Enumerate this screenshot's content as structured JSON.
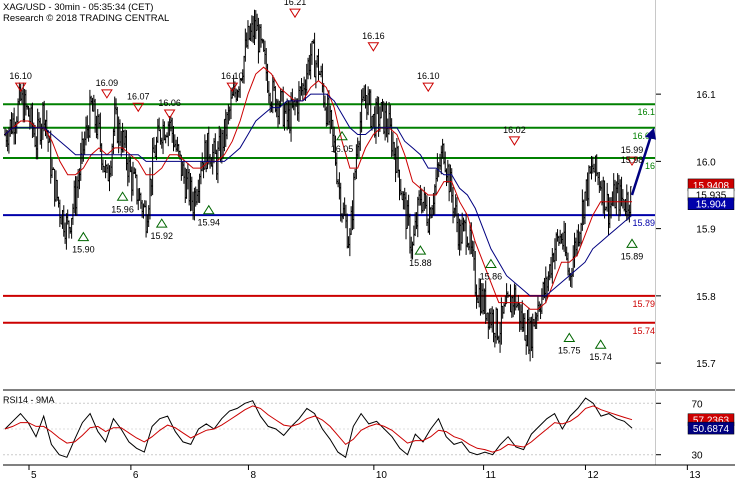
{
  "header": {
    "title": "XAG/USD - 30min - 05:35:34 (CET)",
    "copyright": "Research © 2018 TRADING CENTRAL"
  },
  "chart_data": [
    {
      "type": "candlestick",
      "title": "XAG/USD - 30min - 05:35:34 (CET)",
      "ylim": [
        15.66,
        16.24
      ],
      "grid": false,
      "x_ticks": [
        "5",
        "6",
        "8",
        "10",
        "11",
        "12",
        "13"
      ],
      "y_ticks": [
        "16.1",
        "16.0",
        "15.9",
        "15.8",
        "15.7"
      ],
      "price_path": [
        16.04,
        16.06,
        16.09,
        16.07,
        16.03,
        16.08,
        15.98,
        15.93,
        15.9,
        15.95,
        16.02,
        16.08,
        16.04,
        15.97,
        16.06,
        16.03,
        15.98,
        15.95,
        15.92,
        16.01,
        16.05,
        16.06,
        16.01,
        15.97,
        15.94,
        16.0,
        16.02,
        16.0,
        16.04,
        16.09,
        16.13,
        16.18,
        16.2,
        16.15,
        16.1,
        16.09,
        16.06,
        16.08,
        16.11,
        16.16,
        16.14,
        16.08,
        16.02,
        15.93,
        15.88,
        16.04,
        16.1,
        16.06,
        16.07,
        16.05,
        16.0,
        15.93,
        15.87,
        15.95,
        15.92,
        15.97,
        16.02,
        15.95,
        15.89,
        15.9,
        15.82,
        15.79,
        15.77,
        15.75,
        15.78,
        15.8,
        15.76,
        15.74,
        15.79,
        15.81,
        15.87,
        15.89,
        15.83,
        15.89,
        15.95,
        15.99,
        15.97,
        15.93,
        15.95,
        15.94,
        15.95
      ],
      "moving_averages": [
        {
          "name": "",
          "color": "#cc0000",
          "values": [
            16.04,
            16.05,
            16.06,
            16.06,
            16.05,
            16.05,
            16.03,
            16.0,
            15.98,
            15.98,
            15.99,
            16.01,
            16.02,
            16.01,
            16.02,
            16.02,
            16.01,
            16.0,
            15.98,
            15.98,
            15.99,
            16.01,
            16.01,
            16.0,
            15.99,
            15.99,
            16.0,
            16.0,
            16.01,
            16.03,
            16.06,
            16.1,
            16.13,
            16.14,
            16.13,
            16.11,
            16.1,
            16.09,
            16.09,
            16.11,
            16.12,
            16.11,
            16.08,
            16.03,
            15.99,
            15.99,
            16.02,
            16.04,
            16.05,
            16.05,
            16.04,
            16.01,
            15.97,
            15.96,
            15.95,
            15.95,
            15.97,
            15.97,
            15.94,
            15.92,
            15.88,
            15.85,
            15.82,
            15.79,
            15.79,
            15.79,
            15.79,
            15.78,
            15.78,
            15.79,
            15.82,
            15.85,
            15.85,
            15.86,
            15.89,
            15.92,
            15.94,
            15.94,
            15.94,
            15.94,
            15.94
          ]
        },
        {
          "name": "",
          "color": "#000080",
          "values": [
            16.04,
            16.05,
            16.05,
            16.05,
            16.05,
            16.05,
            16.04,
            16.03,
            16.02,
            16.01,
            16.01,
            16.01,
            16.01,
            16.01,
            16.01,
            16.01,
            16.01,
            16.01,
            16.0,
            16.0,
            16.0,
            16.0,
            16.0,
            16.0,
            16.0,
            16.0,
            16.0,
            16.0,
            16.0,
            16.01,
            16.02,
            16.04,
            16.06,
            16.07,
            16.08,
            16.08,
            16.09,
            16.09,
            16.09,
            16.1,
            16.1,
            16.1,
            16.09,
            16.07,
            16.05,
            16.04,
            16.04,
            16.05,
            16.05,
            16.05,
            16.05,
            16.03,
            16.02,
            16.01,
            15.99,
            15.99,
            15.98,
            15.98,
            15.96,
            15.95,
            15.93,
            15.9,
            15.87,
            15.85,
            15.83,
            15.82,
            15.81,
            15.8,
            15.8,
            15.8,
            15.81,
            15.82,
            15.83,
            15.84,
            15.85,
            15.87,
            15.88,
            15.89,
            15.9,
            15.91,
            15.92
          ]
        }
      ],
      "forecast": {
        "from": 15.95,
        "to": 16.05,
        "color": "#000080"
      },
      "levels": [
        {
          "label": "16.1",
          "value": 16.085,
          "color": "#008000"
        },
        {
          "label": "16.05",
          "value": 16.05,
          "color": "#008000"
        },
        {
          "label": "16",
          "value": 16.005,
          "color": "#008000"
        },
        {
          "label": "15.89",
          "value": 15.92,
          "color": "#0000aa"
        },
        {
          "label": "15.79",
          "value": 15.8,
          "color": "#cc0000"
        },
        {
          "label": "15.74",
          "value": 15.76,
          "color": "#cc0000"
        }
      ],
      "price_badges": [
        {
          "label": "15.9408",
          "value": 15.965,
          "bg": "#cc0000",
          "fg": "#ffffff"
        },
        {
          "label": "15.935",
          "value": 15.951,
          "bg": "#ffffff",
          "fg": "#000000"
        },
        {
          "label": "15.904",
          "value": 15.937,
          "bg": "#0000aa",
          "fg": "#ffffff"
        }
      ],
      "annotations": [
        {
          "label": "16.10",
          "kind": "high",
          "index": 2
        },
        {
          "label": "16.09",
          "kind": "high",
          "index": 13
        },
        {
          "label": "16.07",
          "kind": "high",
          "index": 17
        },
        {
          "label": "16.06",
          "kind": "high",
          "index": 21
        },
        {
          "label": "16.10",
          "kind": "high",
          "index": 29
        },
        {
          "label": "16.21",
          "kind": "high",
          "index": 37
        },
        {
          "label": "16.16",
          "kind": "high",
          "index": 47
        },
        {
          "label": "16.10",
          "kind": "high",
          "index": 54
        },
        {
          "label": "16.02",
          "kind": "high",
          "index": 65
        },
        {
          "label": "15.99",
          "kind": "high",
          "index": 84
        },
        {
          "label": "15.98",
          "kind": "text",
          "index": 91
        },
        {
          "label": "15.90",
          "kind": "low",
          "index": 10
        },
        {
          "label": "15.96",
          "kind": "low",
          "index": 15
        },
        {
          "label": "15.92",
          "kind": "low",
          "index": 20
        },
        {
          "label": "15.94",
          "kind": "low",
          "index": 26
        },
        {
          "label": "16.05",
          "kind": "low",
          "index": 43
        },
        {
          "label": "15.88",
          "kind": "low",
          "index": 53
        },
        {
          "label": "15.86",
          "kind": "low",
          "index": 62
        },
        {
          "label": "15.75",
          "kind": "low",
          "index": 72
        },
        {
          "label": "15.74",
          "kind": "low",
          "index": 76
        },
        {
          "label": "15.89",
          "kind": "low",
          "index": 87
        }
      ]
    },
    {
      "type": "line",
      "title": "RSI14 - 9MA",
      "ylim": [
        22,
        78
      ],
      "y_ticks": [
        "70",
        "30"
      ],
      "series": [
        {
          "name": "",
          "color": "#000000",
          "values": [
            50,
            56,
            62,
            55,
            44,
            60,
            38,
            30,
            28,
            42,
            55,
            62,
            48,
            40,
            58,
            50,
            40,
            35,
            32,
            52,
            58,
            60,
            48,
            40,
            38,
            50,
            54,
            50,
            58,
            64,
            66,
            70,
            72,
            60,
            52,
            50,
            45,
            52,
            58,
            66,
            62,
            50,
            42,
            32,
            28,
            52,
            62,
            54,
            56,
            50,
            44,
            35,
            30,
            46,
            40,
            50,
            58,
            44,
            38,
            40,
            32,
            30,
            32,
            30,
            38,
            44,
            36,
            34,
            46,
            52,
            58,
            62,
            50,
            60,
            66,
            74,
            70,
            60,
            62,
            58,
            56,
            50.6874
          ]
        },
        {
          "name": "",
          "color": "#cc0000",
          "values": [
            50,
            52,
            55,
            55,
            52,
            52,
            48,
            43,
            39,
            40,
            45,
            51,
            52,
            48,
            51,
            51,
            47,
            43,
            40,
            44,
            49,
            53,
            51,
            47,
            43,
            46,
            49,
            50,
            53,
            57,
            61,
            65,
            68,
            66,
            61,
            57,
            53,
            52,
            54,
            58,
            60,
            57,
            52,
            45,
            38,
            42,
            49,
            52,
            54,
            52,
            49,
            44,
            39,
            41,
            41,
            44,
            49,
            48,
            44,
            42,
            38,
            35,
            34,
            32,
            34,
            38,
            37,
            36,
            40,
            45,
            50,
            55,
            54,
            56,
            60,
            66,
            68,
            65,
            63,
            61,
            59,
            57.2363
          ]
        }
      ],
      "badges": [
        {
          "label": "57.2363",
          "value": 57.2363,
          "bg": "#cc0000",
          "fg": "#ffffff"
        },
        {
          "label": "50.6874",
          "value": 50.6874,
          "bg": "#000080",
          "fg": "#ffffff"
        }
      ]
    }
  ]
}
